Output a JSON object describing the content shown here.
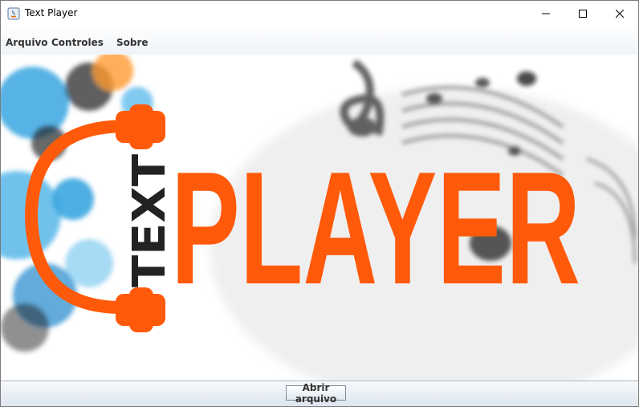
{
  "window": {
    "title": "Text Player",
    "controls": [
      "minimize-icon",
      "maximize-icon",
      "close-icon"
    ]
  },
  "menu": {
    "items": [
      {
        "label": "Arquivo"
      },
      {
        "label": "Controles"
      },
      {
        "label": "Sobre"
      }
    ]
  },
  "logo": {
    "word_vertical": "TEXT",
    "word_main": "PLAYER",
    "colors": {
      "orange": "#ff5a0a",
      "dark": "#222222",
      "blue": "#3aa6e0"
    }
  },
  "footer": {
    "open_button_label": "Abrir arquivo"
  }
}
